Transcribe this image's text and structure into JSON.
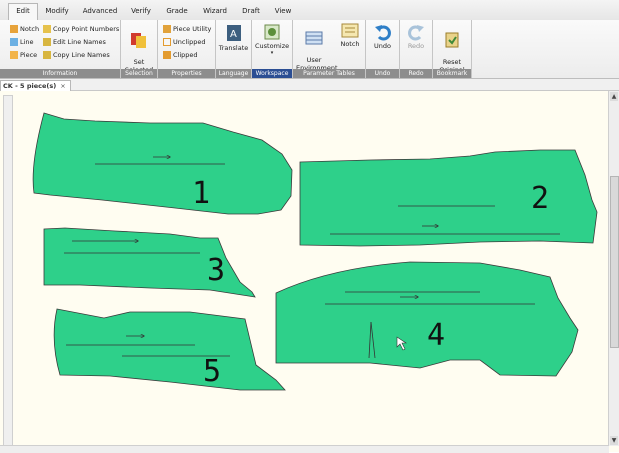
{
  "menu": {
    "tabs": [
      "Edit",
      "Modify",
      "Advanced",
      "Verify",
      "Grade",
      "Wizard",
      "Draft",
      "View"
    ],
    "active": "Edit"
  },
  "ribbon": {
    "information": {
      "label": "Information",
      "notch": "Notch",
      "line": "Line",
      "piece": "Piece",
      "copy_point_numbers": "Copy Point Numbers",
      "edit_line_names": "Edit Line Names",
      "copy_line_names": "Copy Line Names"
    },
    "selection": {
      "label": "Selection",
      "set_selected": "Set\nSelected"
    },
    "properties": {
      "label": "Properties",
      "piece_utility": "Piece Utility",
      "unclipped": "Unclipped",
      "clipped": "Clipped"
    },
    "language": {
      "label": "Language",
      "translate": "Translate"
    },
    "workspace": {
      "label": "Workspace",
      "customize": "Customize"
    },
    "parameter_tables": {
      "label": "Parameter Tables",
      "user_environment": "User\nEnvironment",
      "notch": "Notch"
    },
    "undo": {
      "label": "Undo",
      "undo": "Undo"
    },
    "redo": {
      "label": "Redo",
      "redo": "Redo"
    },
    "bookmark": {
      "label": "Bookmark",
      "reset_original": "Reset\nOriginal"
    }
  },
  "doc_tab": {
    "title": "CK - 5 piece(s)",
    "close": "×"
  },
  "pieces": {
    "p1": {
      "number": "1",
      "fill": "#2ed08a"
    },
    "p2": {
      "number": "2",
      "fill": "#2ed08a"
    },
    "p3": {
      "number": "3",
      "fill": "#2ed08a"
    },
    "p4": {
      "number": "4",
      "fill": "#2ed08a"
    },
    "p5": {
      "number": "5",
      "fill": "#2ed08a"
    }
  },
  "colors": {
    "canvas_bg": "#fffdf1",
    "piece_fill": "#2ed08a",
    "piece_stroke": "#3a3a3a"
  }
}
